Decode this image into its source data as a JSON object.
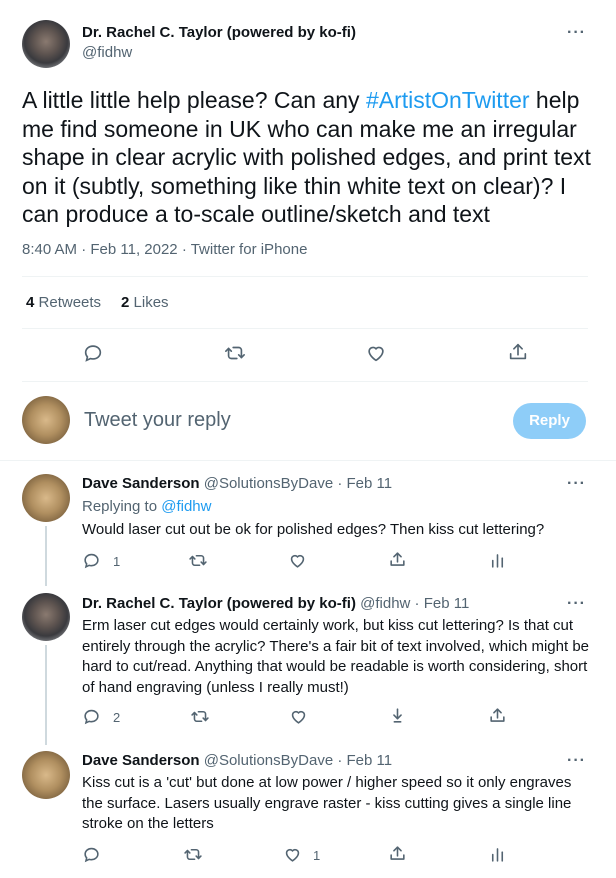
{
  "main_tweet": {
    "author_name": "Dr. Rachel C. Taylor (powered by ko-fi)",
    "author_handle": "@fidhw",
    "text_before": "A little little help please? Can any ",
    "hashtag": "#ArtistOnTwitter",
    "text_after": " help me find someone in UK who can make me an irregular shape in clear acrylic with polished edges, and print text on it (subtly, something like thin white text on clear)? I can produce a to-scale outline/sketch and text",
    "timestamp": "8:40 AM · Feb 11, 2022 · Twitter for iPhone",
    "retweets_count": "4",
    "retweets_label": "Retweets",
    "likes_count": "2",
    "likes_label": "Likes"
  },
  "reply_box": {
    "placeholder": "Tweet your reply",
    "button_label": "Reply"
  },
  "replies": [
    {
      "author_name": "Dave Sanderson",
      "author_handle": "@SolutionsByDave · Feb 11",
      "replying_to_label": "Replying to ",
      "replying_to_handle": "@fidhw",
      "text": "Would laser cut out be ok for polished edges? Then kiss cut lettering?",
      "reply_count": "1",
      "retweet_count": "",
      "like_count": ""
    },
    {
      "author_name": "Dr. Rachel C. Taylor (powered by ko-fi)",
      "author_handle": "@fidhw · Feb 11",
      "text": "Erm laser cut edges would certainly work, but kiss cut lettering? Is that cut entirely through the acrylic? There's a fair bit of text involved, which might be hard to cut/read. Anything that would be readable is worth considering, short of hand engraving (unless I really must!)",
      "reply_count": "2",
      "retweet_count": "",
      "like_count": ""
    },
    {
      "author_name": "Dave Sanderson",
      "author_handle": "@SolutionsByDave · Feb 11",
      "text": "Kiss cut is a 'cut' but done at low power / higher speed so it only engraves the surface. Lasers usually engrave raster - kiss cutting gives a single line stroke on the letters",
      "reply_count": "",
      "retweet_count": "",
      "like_count": "1"
    }
  ],
  "more_glyph": "···",
  "colors": {
    "accent": "#1d9bf0",
    "reply_button_disabled": "#8ecdf8",
    "text_secondary": "#536471",
    "divider": "#eff3f4"
  }
}
